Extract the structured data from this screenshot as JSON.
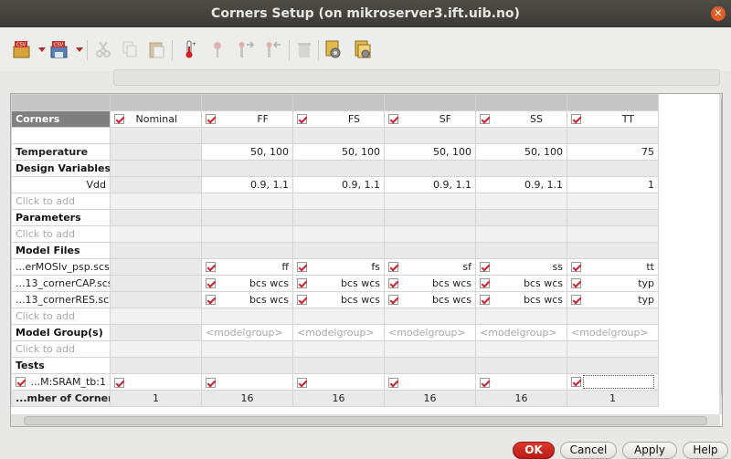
{
  "window": {
    "title": "Corners Setup (on mikroserver3.ift.uib.no)"
  },
  "toolbar": {
    "icons": [
      "open-csv-icon",
      "save-csv-icon",
      "cut-icon",
      "copy-icon",
      "paste-icon",
      "temperature-icon",
      "parameter-icon",
      "param-up-icon",
      "param-down-icon",
      "delete-icon",
      "setup-icon",
      "model-icon"
    ]
  },
  "table": {
    "corners_label": "Corners",
    "columns": [
      "Nominal",
      "FF",
      "FS",
      "SF",
      "SS",
      "TT"
    ],
    "temperature": {
      "label": "Temperature",
      "values": [
        "",
        "50, 100",
        "50, 100",
        "50, 100",
        "50, 100",
        "75"
      ]
    },
    "design_variables": {
      "label": "Design Variables",
      "var": "Vdd",
      "values": [
        "",
        "0.9, 1.1",
        "0.9, 1.1",
        "0.9, 1.1",
        "0.9, 1.1",
        "1"
      ]
    },
    "click_to_add": "Click to add",
    "parameters": {
      "label": "Parameters"
    },
    "model_files": {
      "label": "Model Files",
      "rows": [
        {
          "name": "...erMOSlv_psp.scs",
          "values": [
            "ff",
            "fs",
            "sf",
            "ss",
            "tt"
          ]
        },
        {
          "name": "...13_cornerCAP.scs",
          "values": [
            "bcs wcs",
            "bcs wcs",
            "bcs wcs",
            "bcs wcs",
            "typ"
          ]
        },
        {
          "name": "...13_cornerRES.scs",
          "values": [
            "bcs wcs",
            "bcs wcs",
            "bcs wcs",
            "bcs wcs",
            "typ"
          ]
        }
      ]
    },
    "model_groups": {
      "label": "Model Group(s)",
      "placeholder": "<modelgroup>"
    },
    "tests": {
      "label": "Tests",
      "row": "...M:SRAM_tb:1"
    },
    "num_corners": {
      "label": "...mber of Corners",
      "values": [
        "1",
        "16",
        "16",
        "16",
        "16",
        "1"
      ]
    }
  },
  "buttons": {
    "ok": "OK",
    "cancel": "Cancel",
    "apply": "Apply",
    "help": "Help"
  }
}
